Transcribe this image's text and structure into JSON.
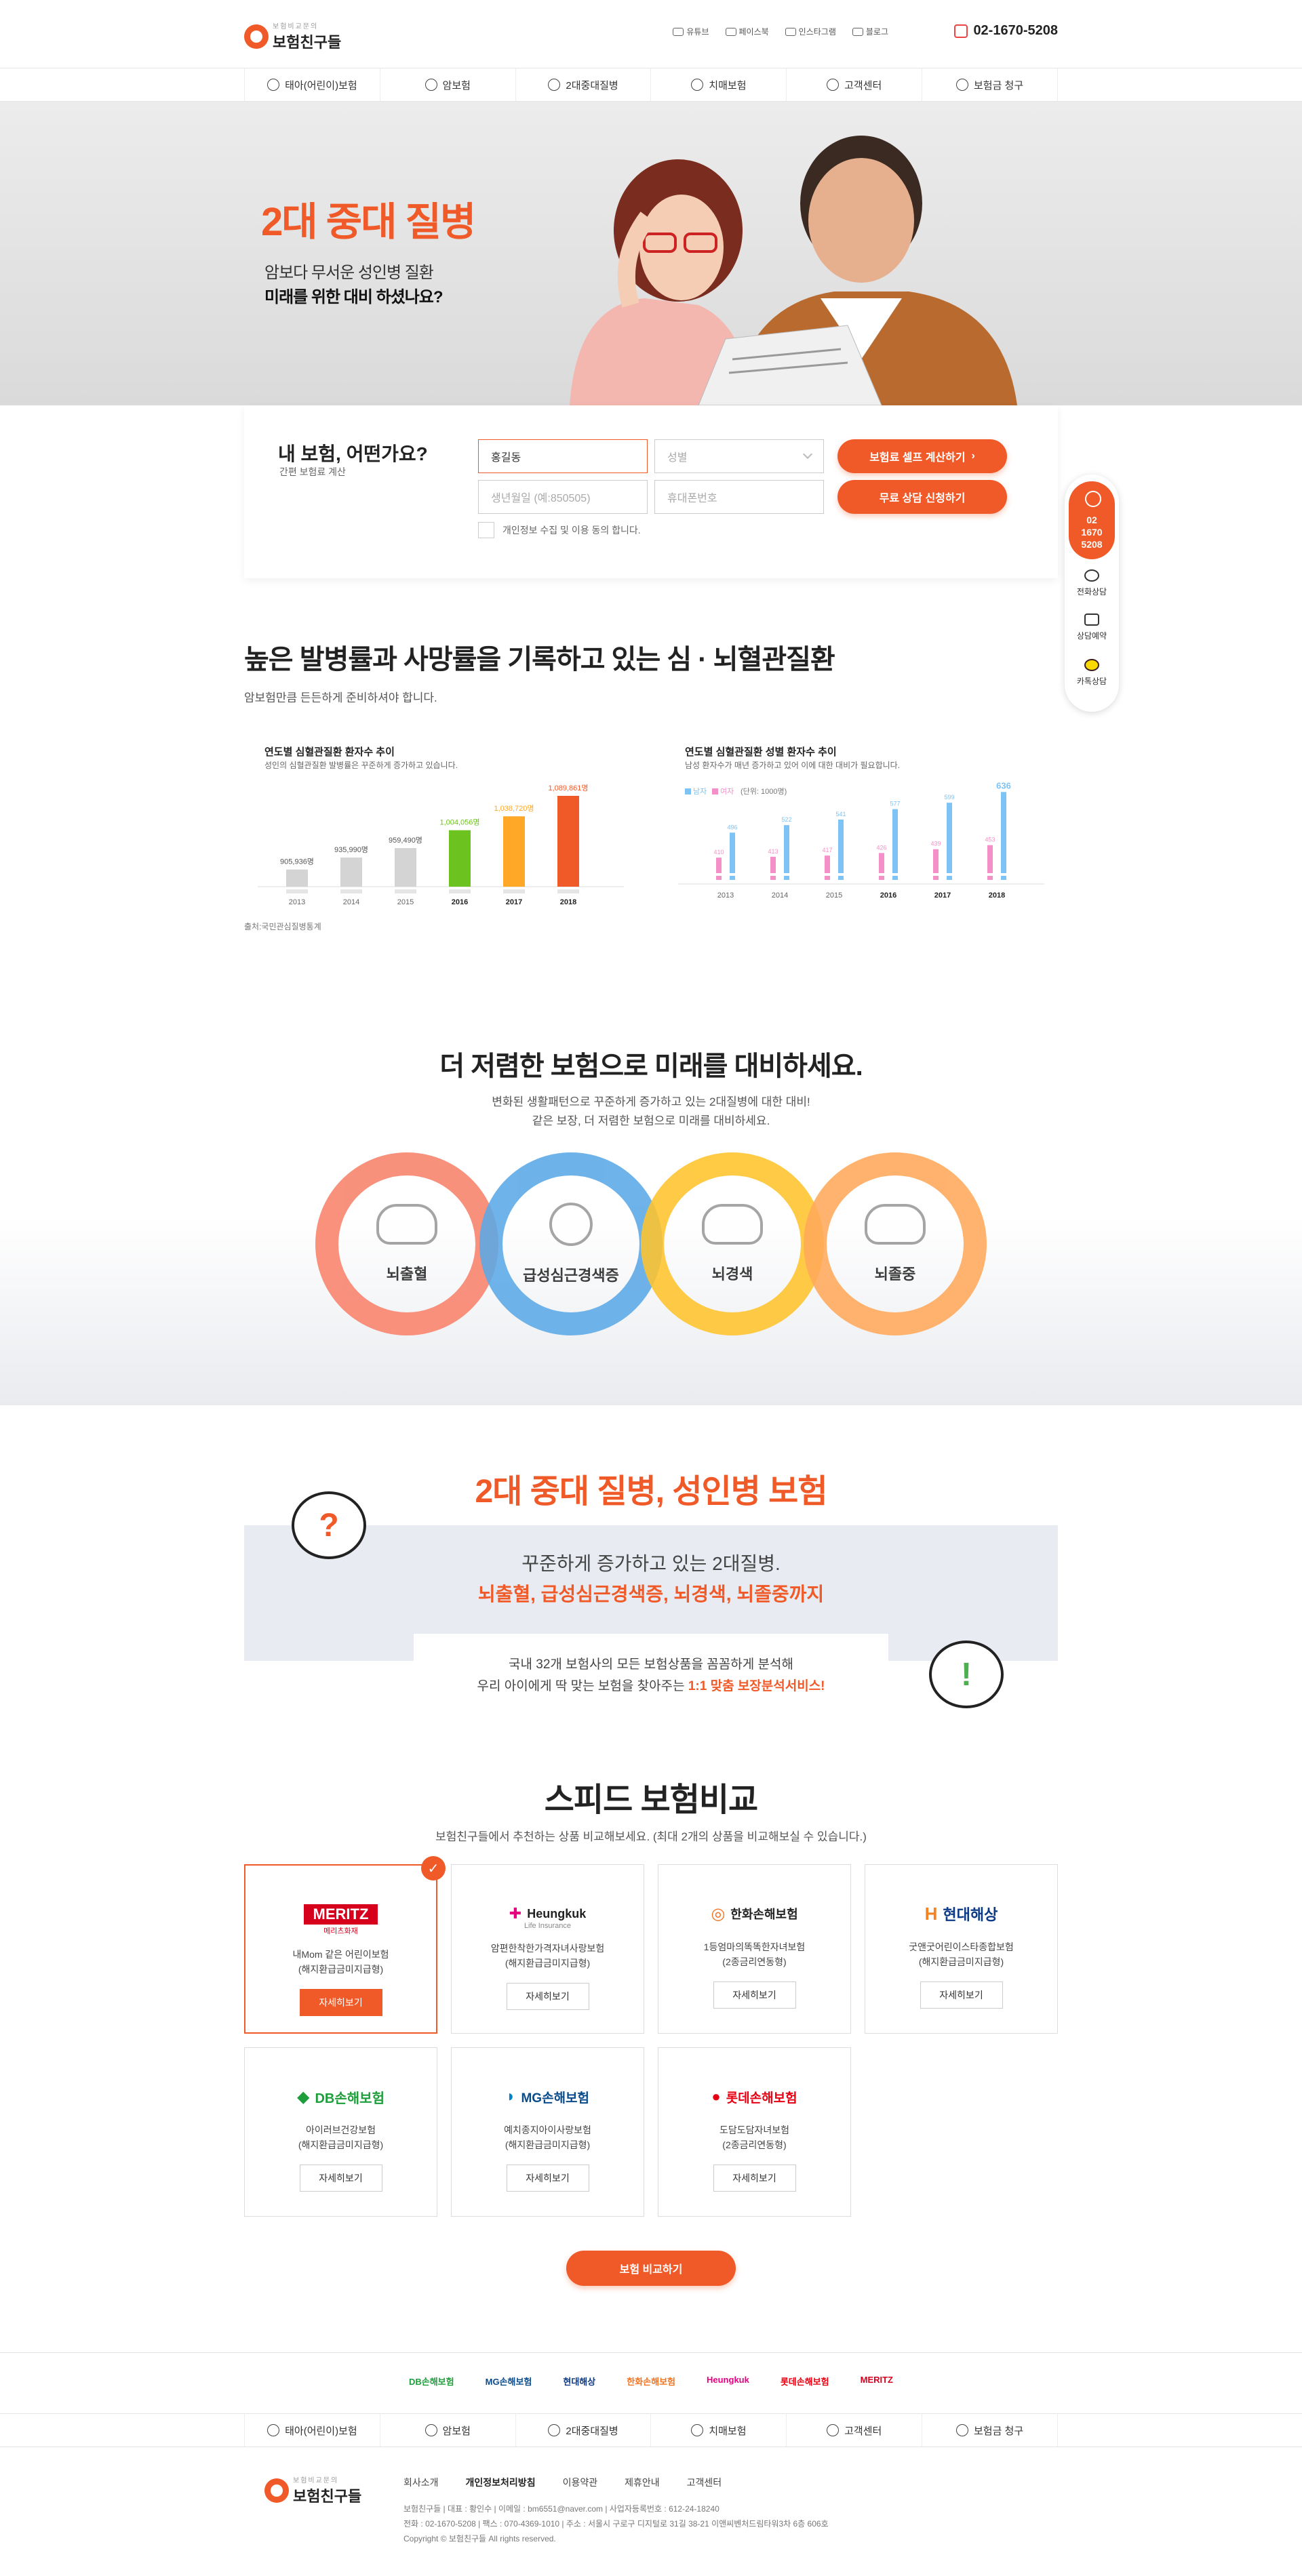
{
  "header": {
    "logo_sub": "보험비교문의",
    "logo_name": "보험친구들",
    "sns": [
      "유튜브",
      "페이스북",
      "인스타그램",
      "블로그"
    ],
    "phone": "02-1670-5208"
  },
  "nav": [
    "태아(어린이)보험",
    "암보험",
    "2대중대질병",
    "치매보험",
    "고객센터",
    "보험금 청구"
  ],
  "hero": {
    "title": "2대 중대 질병",
    "line1": "암보다 무서운 성인병 질환",
    "line2": "미래를 위한 대비 하셨나요?"
  },
  "calc": {
    "title": "내 보험, 어떤가요?",
    "sub": "간편 보험료 계산",
    "name_value": "홍길동",
    "gender_placeholder": "성별",
    "birth_placeholder": "생년월일 (예:850505)",
    "phone_placeholder": "휴대폰번호",
    "btn_calc": "보험료 셀프 계산하기",
    "btn_consult": "무료 상담 신청하기",
    "agree": "개인정보 수집 및 이용 동의 합니다."
  },
  "quick": {
    "phone": "02\n1670\n5208",
    "items": [
      "전화상담",
      "상담예약",
      "카톡상담"
    ]
  },
  "stats": {
    "title": "높은 발병률과 사망률을 기록하고 있는 심 · 뇌혈관질환",
    "sub": "암보험만큼 든든하게 준비하셔야 합니다.",
    "source": "출처:국민관심질병통계",
    "colors": {
      "gray": "#d4d4d4",
      "green": "#6cc21e",
      "orange1": "#ffa726",
      "orange2": "#f05a28",
      "male": "#7ec3f5",
      "female": "#f58fc8"
    }
  },
  "chart_data": [
    {
      "type": "bar",
      "title": "연도별 심혈관질환 환자수 추이",
      "subtitle": "성인의 심혈관질환 발병률은 꾸준하게 증가하고 있습니다.",
      "categories": [
        "2013",
        "2014",
        "2015",
        "2016",
        "2017",
        "2018"
      ],
      "values": [
        905936,
        935990,
        959490,
        1004056,
        1038720,
        1089861
      ],
      "labels": [
        "905,936명",
        "935,990명",
        "959,490명",
        "1,004,056명",
        "1,038,720명",
        "1,089,861명"
      ]
    },
    {
      "type": "bar",
      "title": "연도별 심혈관질환 성별 환자수 추이",
      "subtitle": "남성 환자수가 매년 증가하고 있어 이에 대한 대비가 필요합니다.",
      "legend": [
        "남자",
        "여자"
      ],
      "unit": "(단위: 1000명)",
      "categories": [
        "2013",
        "2014",
        "2015",
        "2016",
        "2017",
        "2018"
      ],
      "series": [
        {
          "name": "남자",
          "values": [
            496,
            522,
            541,
            577,
            599,
            636
          ]
        },
        {
          "name": "여자",
          "values": [
            410,
            413,
            417,
            426,
            439,
            453
          ]
        }
      ]
    }
  ],
  "diseases": {
    "title": "더 저렴한 보험으로 미래를 대비하세요.",
    "sub1": "변화된 생활패턴으로 꾸준하게 증가하고 있는 2대질병에 대한 대비!",
    "sub2": "같은 보장, 더 저렴한 보험으로 미래를 대비하세요.",
    "items": [
      "뇌출혈",
      "급성심근경색증",
      "뇌경색",
      "뇌졸중"
    ],
    "colors": [
      "#f8826b",
      "#5aa8e6",
      "#ffc32b",
      "#ffa85a"
    ]
  },
  "promo": {
    "title": "2대 중대 질병, 성인병 보험",
    "line1": "꾸준하게 증가하고 있는 2대질병.",
    "line2": "뇌출혈, 급성심근경색증, 뇌경색, 뇌졸중까지",
    "text1": "국내 32개 보험사의 모든 보험상품을 꼼꼼하게 분석해",
    "text2": "우리 아이에게 딱 맞는 보험을 찾아주는",
    "text2_hl": "1:1 맞춤 보장분석서비스!"
  },
  "compare": {
    "title": "스피드 보험비교",
    "sub": "보험친구들에서 추천하는 상품 비교해보세요. (최대 2개의 상품을 비교해보실 수 있습니다.)",
    "more": "자세히보기",
    "button": "보험 비교하기",
    "items": [
      {
        "brand": "MERITZ",
        "brand_sub": "메리츠화재",
        "name": "내Mom 같은 어린이보험",
        "type": "(해지환급금미지급형)"
      },
      {
        "brand": "Heungkuk",
        "brand_sub": "Life Insurance",
        "name": "암편한착한가격자녀사랑보험",
        "type": "(해지환급금미지급형)"
      },
      {
        "brand": "한화손해보험",
        "brand_sub": "",
        "name": "1등엄마의똑똑한자녀보험",
        "type": "(2종금리연동형)"
      },
      {
        "brand": "현대해상",
        "brand_sub": "",
        "name": "굿앤굿어린이스타종합보험",
        "type": "(해지환급금미지급형)"
      },
      {
        "brand": "DB손해보험",
        "brand_sub": "",
        "name": "아이러브건강보험",
        "type": "(해지환급금미지급형)"
      },
      {
        "brand": "MG손해보험",
        "brand_sub": "",
        "name": "예치종지아이사랑보험",
        "type": "(해지환급금미지급형)"
      },
      {
        "brand": "롯데손해보험",
        "brand_sub": "",
        "name": "도담도담자녀보험",
        "type": "(2종금리연동형)"
      }
    ]
  },
  "partners": [
    "DB손해보험",
    "MG손해보험",
    "현대해상",
    "한화손해보험",
    "Heungkuk",
    "롯데손해보험",
    "MERITZ"
  ],
  "footer": {
    "nav": [
      "회사소개",
      "개인정보처리방침",
      "이용약관",
      "제휴안내",
      "고객센터"
    ],
    "line1": "보험친구들  |  대표 : 황인수  |  이메일 : bm6551@naver.com  |  사업자등록번호 : 612-24-18240",
    "line2": "전화 : 02-1670-5208  |  팩스 : 070-4369-1010  |  주소 : 서울시 구로구 디지털로 31길 38-21 이앤씨벤처드림타워3차 6층 606호",
    "line3": "Copyright © 보험친구들 All rights reserved."
  }
}
